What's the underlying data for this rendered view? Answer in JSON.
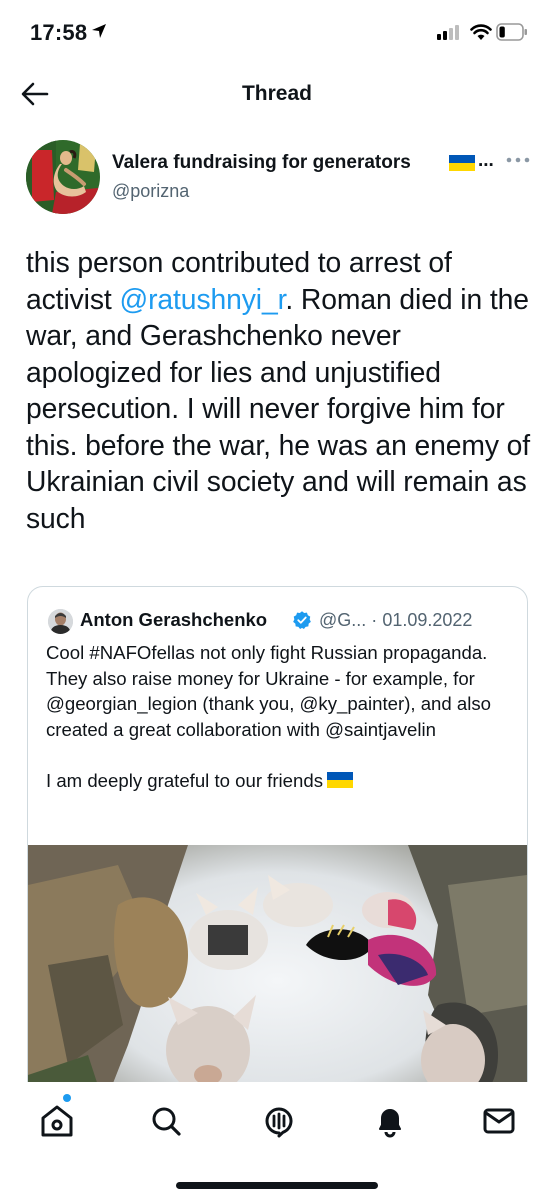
{
  "status_bar": {
    "time": "17:58",
    "battery_level": 0.25
  },
  "header": {
    "title": "Thread"
  },
  "author": {
    "name": "Valera fundraising for generators",
    "name_suffix": "...",
    "handle": "@porizna"
  },
  "tweet": {
    "text_before": "this person contributed to arrest of activist ",
    "mention": "@ratushnyi_r",
    "text_after": ". Roman died in the war, and Gerashchenko never apologized for lies and unjustified persecution. I will never forgive him for this. before the war, he was an enemy of Ukrainian civil society and will remain as such"
  },
  "quoted_tweet": {
    "author_name": "Anton Gerashchenko",
    "handle": "@G...",
    "separator": "·",
    "date": "01.09.2022",
    "paragraph1": "Cool #NAFOfellas not only fight Russian propaganda. They also raise money for Ukraine - for example, for @georgian_legion (thank you, @ky_painter), and also created a great collaboration with @saintjavelin",
    "paragraph2": "I am deeply grateful to our friends"
  },
  "tab_bar": {
    "items": [
      {
        "icon": "home-icon",
        "label": "Home",
        "active": true
      },
      {
        "icon": "search-icon",
        "label": "Search"
      },
      {
        "icon": "spaces-icon",
        "label": "Spaces"
      },
      {
        "icon": "bell-icon",
        "label": "Notifications"
      },
      {
        "icon": "mail-icon",
        "label": "Messages"
      }
    ]
  },
  "colors": {
    "accent": "#1d9bf0",
    "text": "#0f1419",
    "secondary": "#536471",
    "border": "#cfd9de",
    "flag_blue": "#0057b7",
    "flag_yellow": "#ffd700"
  }
}
